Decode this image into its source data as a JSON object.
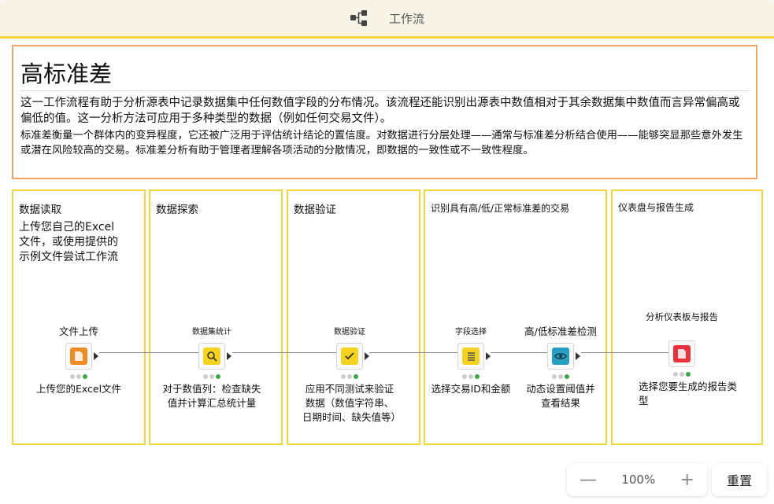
{
  "header": {
    "title": "工作流",
    "icon": "workflow-icon"
  },
  "annotation": {
    "heading": "高标准差",
    "description1": "这一工作流程有助于分析源表中记录数据集中任何数值字段的分布情况。该流程还能识别出源表中数值相对于其余数据集中数值而言异常偏高或偏低的值。这一分析方法可应用于多种类型的数据（例如任何交易文件）。",
    "description2": "标准差衡量一个群体内的变异程度，它还被广泛用于评估统计结论的置信度。对数据进行分层处理——通常与标准差分析结合使用——能够突显那些意外发生或潜在风险较高的交易。标准差分析有助于管理者理解各项活动的分散情况，即数据的一致性或不一致性程度。"
  },
  "sections": [
    {
      "title": "数据读取",
      "subtitle": "上传您自己的Excel\n文件，或使用提供的\n示例文件尝试工作流"
    },
    {
      "title": "数据探索"
    },
    {
      "title": "数据验证"
    },
    {
      "title": "识别具有高/低/正常标准差的交易"
    },
    {
      "title": "仪表盘与报告生成"
    }
  ],
  "nodes": [
    {
      "label": "文件上传",
      "caption": "上传您的Excel文件",
      "color": "#f08a24",
      "icon": "file-upload-icon"
    },
    {
      "label": "数据集统计",
      "caption": "对于数值列：检查缺失值并计算汇总统计量",
      "color": "#f4d21f",
      "icon": "magnifier-icon"
    },
    {
      "label": "数据验证",
      "caption": "应用不同测试来验证数据（数值字符串、日期时间、缺失值等）",
      "color": "#f4d21f",
      "icon": "checkmark-icon"
    },
    {
      "label": "字段选择",
      "caption": "选择交易ID和金额",
      "color": "#f4d21f",
      "icon": "list-select-icon"
    },
    {
      "label": "高/低标准差检测",
      "caption": "动态设置阈值并查看结果",
      "color": "#2a9fc4",
      "icon": "eye-icon"
    },
    {
      "label": "分析仪表板与报告",
      "caption": "选择您要生成的报告类型",
      "color": "#e8313b",
      "icon": "report-icon"
    }
  ],
  "controls": {
    "zoom_out": "—",
    "zoom_level": "100%",
    "zoom_in": "+",
    "reset": "重置"
  }
}
